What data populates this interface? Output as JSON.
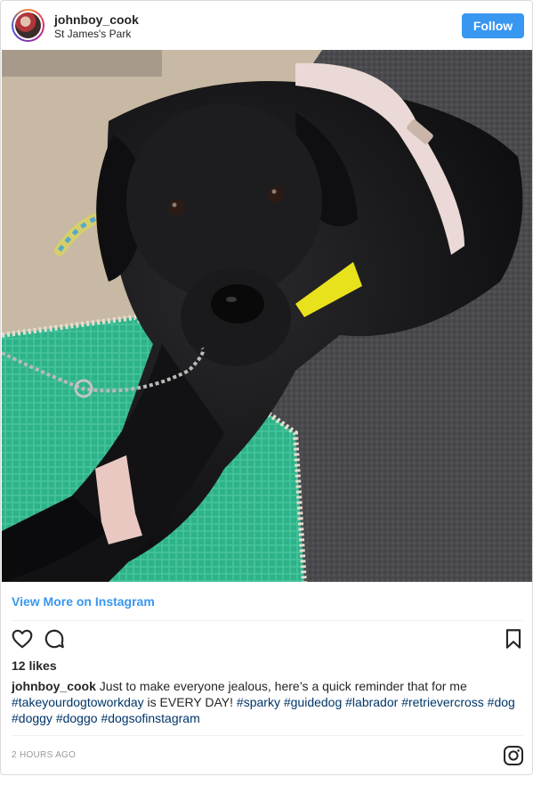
{
  "post": {
    "username": "johnboy_cook",
    "location": "St James's Park",
    "follow_label": "Follow",
    "view_more_label": "View More on Instagram",
    "likes": "12 likes",
    "caption": {
      "author": "johnboy_cook",
      "text_1": " Just to make everyone jealous, here’s a quick reminder that for me ",
      "tag_1": "#takeyourdogtoworkday",
      "text_2": " is EVERY DAY! ",
      "tags": [
        "#sparky",
        "#guidedog",
        "#labrador",
        "#retrievercross",
        "#dog",
        "#doggy",
        "#doggo",
        "#dogsofinstagram"
      ]
    },
    "timestamp": "2 hours ago"
  },
  "icons": {
    "like": "heart-icon",
    "comment": "comment-icon",
    "save": "bookmark-icon",
    "brand": "instagram-logo-icon"
  },
  "colors": {
    "accent": "#3897f0",
    "hashtag": "#003569",
    "text": "#262626",
    "muted": "#999999",
    "border": "#dbdbdb"
  }
}
